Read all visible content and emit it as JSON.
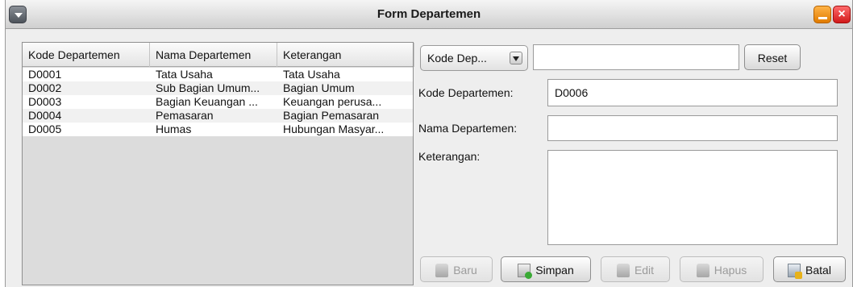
{
  "window": {
    "title": "Form Departemen"
  },
  "table": {
    "columns": [
      "Kode Departemen",
      "Nama Departemen",
      "Keterangan"
    ],
    "rows": [
      [
        "D0001",
        "Tata Usaha",
        "Tata Usaha"
      ],
      [
        "D0002",
        "Sub Bagian Umum...",
        "Bagian Umum"
      ],
      [
        "D0003",
        "Bagian Keuangan ...",
        "Keuangan perusa..."
      ],
      [
        "D0004",
        "Pemasaran",
        "Bagian Pemasaran"
      ],
      [
        "D0005",
        "Humas",
        "Hubungan Masyar..."
      ]
    ]
  },
  "search": {
    "selected": "Kode Dep...",
    "value": "",
    "reset_label": "Reset"
  },
  "form": {
    "kode_label": "Kode Departemen:",
    "kode_value": "D0006",
    "nama_label": "Nama Departemen:",
    "nama_value": "",
    "keterangan_label": "Keterangan:",
    "keterangan_value": ""
  },
  "buttons": {
    "baru": "Baru",
    "simpan": "Simpan",
    "edit": "Edit",
    "hapus": "Hapus",
    "batal": "Batal"
  },
  "icons": {
    "system_menu": "dropdown-arrow-icon",
    "minimize": "minimize-icon",
    "close": "close-icon",
    "baru": "database-icon",
    "simpan": "save-icon",
    "edit": "edit-icon",
    "hapus": "delete-icon",
    "batal": "cancel-icon"
  }
}
